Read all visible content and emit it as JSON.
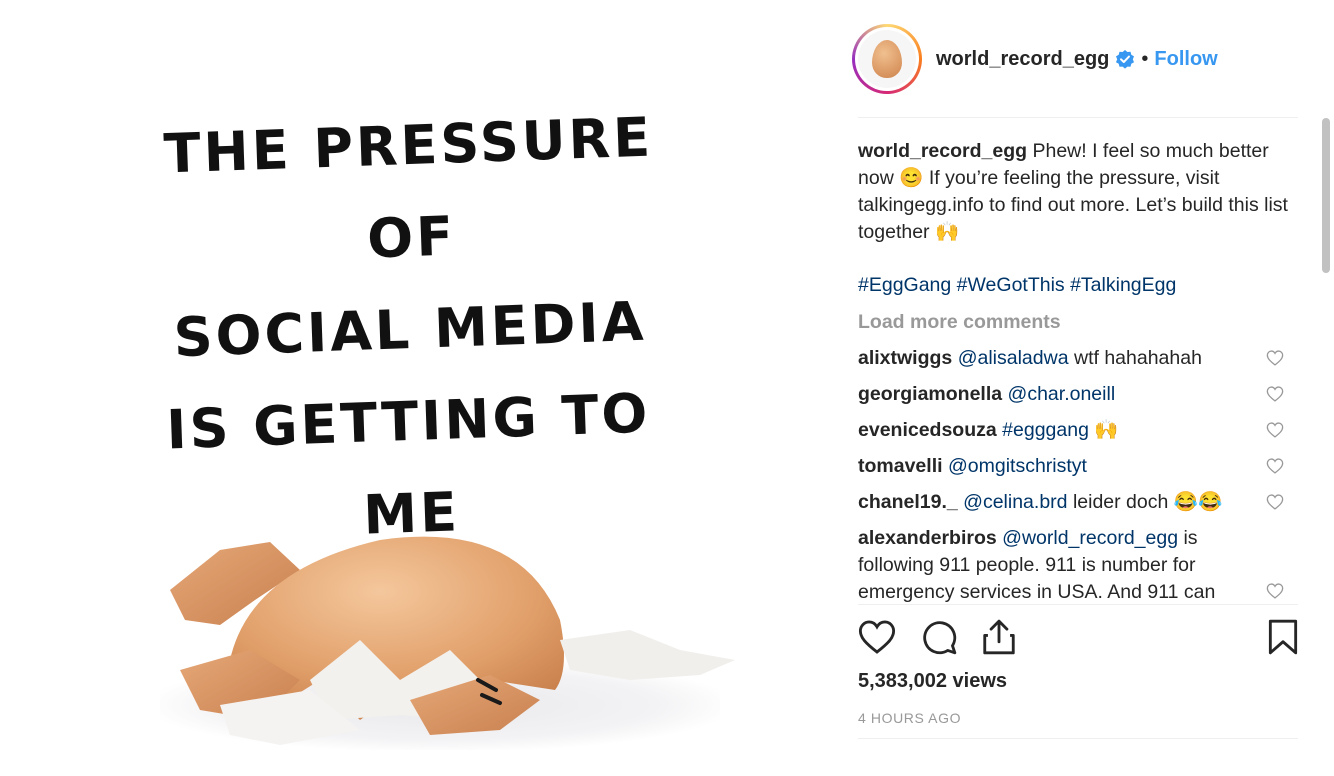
{
  "media": {
    "image_lines": [
      "THE PRESSURE OF",
      "SOCIAL MEDIA",
      "IS GETTING TO ME"
    ]
  },
  "header": {
    "username": "world_record_egg",
    "separator": "•",
    "follow_label": "Follow"
  },
  "caption": {
    "username": "world_record_egg",
    "text": "Phew! I feel so much better now 😊 If you’re feeling the pressure, visit talkingegg.info to find out more. Let’s build this list together 🙌",
    "hashtags": "#EggGang #WeGotThis #TalkingEgg"
  },
  "load_more": "Load more comments",
  "comments": [
    {
      "user": "alixtwiggs",
      "mention": "@alisaladwa",
      "text": "wtf hahahahah"
    },
    {
      "user": "georgiamonella",
      "mention": "@char.oneill",
      "text": ""
    },
    {
      "user": "evenicedsouza",
      "mention": "#egggang",
      "text": "🙌"
    },
    {
      "user": "tomavelli",
      "mention": "@omgitschristyt",
      "text": ""
    },
    {
      "user": "chanel19._",
      "mention": "@celina.brd",
      "text": "leider doch 😂😂"
    },
    {
      "user": "alexanderbiros",
      "mention": "@world_record_egg",
      "text": "is following 911 people. 911 is number for emergency services in USA. And 911 can"
    }
  ],
  "stats": {
    "views": "5,383,002 views",
    "time_ago": "4 HOURS AGO"
  },
  "colors": {
    "link": "#3897f0",
    "mention": "#003569",
    "muted": "#999999"
  }
}
